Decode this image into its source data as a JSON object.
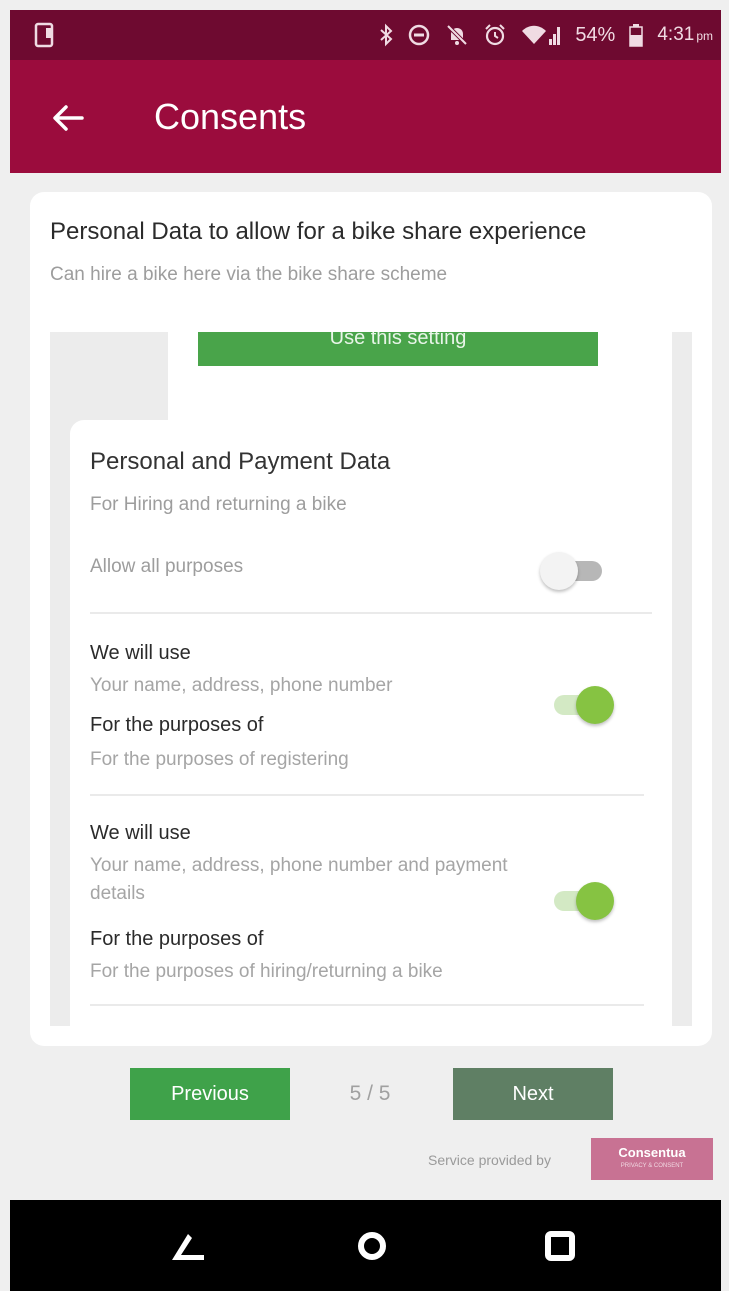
{
  "status_bar": {
    "battery": "54%",
    "time": "4:31",
    "ampm": "pm"
  },
  "app_bar": {
    "title": "Consents"
  },
  "card": {
    "heading": "Personal Data to allow for a bike share experience",
    "subheading": "Can hire a bike here via the bike share scheme",
    "previous_panel_button": "Use this setting"
  },
  "panel": {
    "title": "Personal and Payment Data",
    "subtitle": "For Hiring and returning a bike",
    "allow_all_label": "Allow all purposes",
    "allow_all_on": false,
    "items": [
      {
        "use_label": "We will use",
        "use_text": "Your name, address, phone number",
        "purpose_label": "For the purposes of",
        "purpose_text": "For the purposes of registering",
        "enabled": true
      },
      {
        "use_label": "We will use",
        "use_text": "Your name, address, phone number and payment details",
        "purpose_label": "For the purposes of",
        "purpose_text": "For the purposes of hiring/returning a bike",
        "enabled": true
      }
    ]
  },
  "pager": {
    "previous_label": "Previous",
    "page_indicator": "5 / 5",
    "next_label": "Next"
  },
  "footer": {
    "service_text": "Service provided by",
    "logo_text": "Consentua",
    "logo_subtext": "PRIVACY & CONSENT"
  },
  "colors": {
    "status_bar": "#6e0a30",
    "app_bar": "#9b0c3d",
    "button_green": "#3fa24a",
    "next_button": "#5f7f64",
    "toggle_on": "#86c342",
    "logo": "#c87293"
  }
}
